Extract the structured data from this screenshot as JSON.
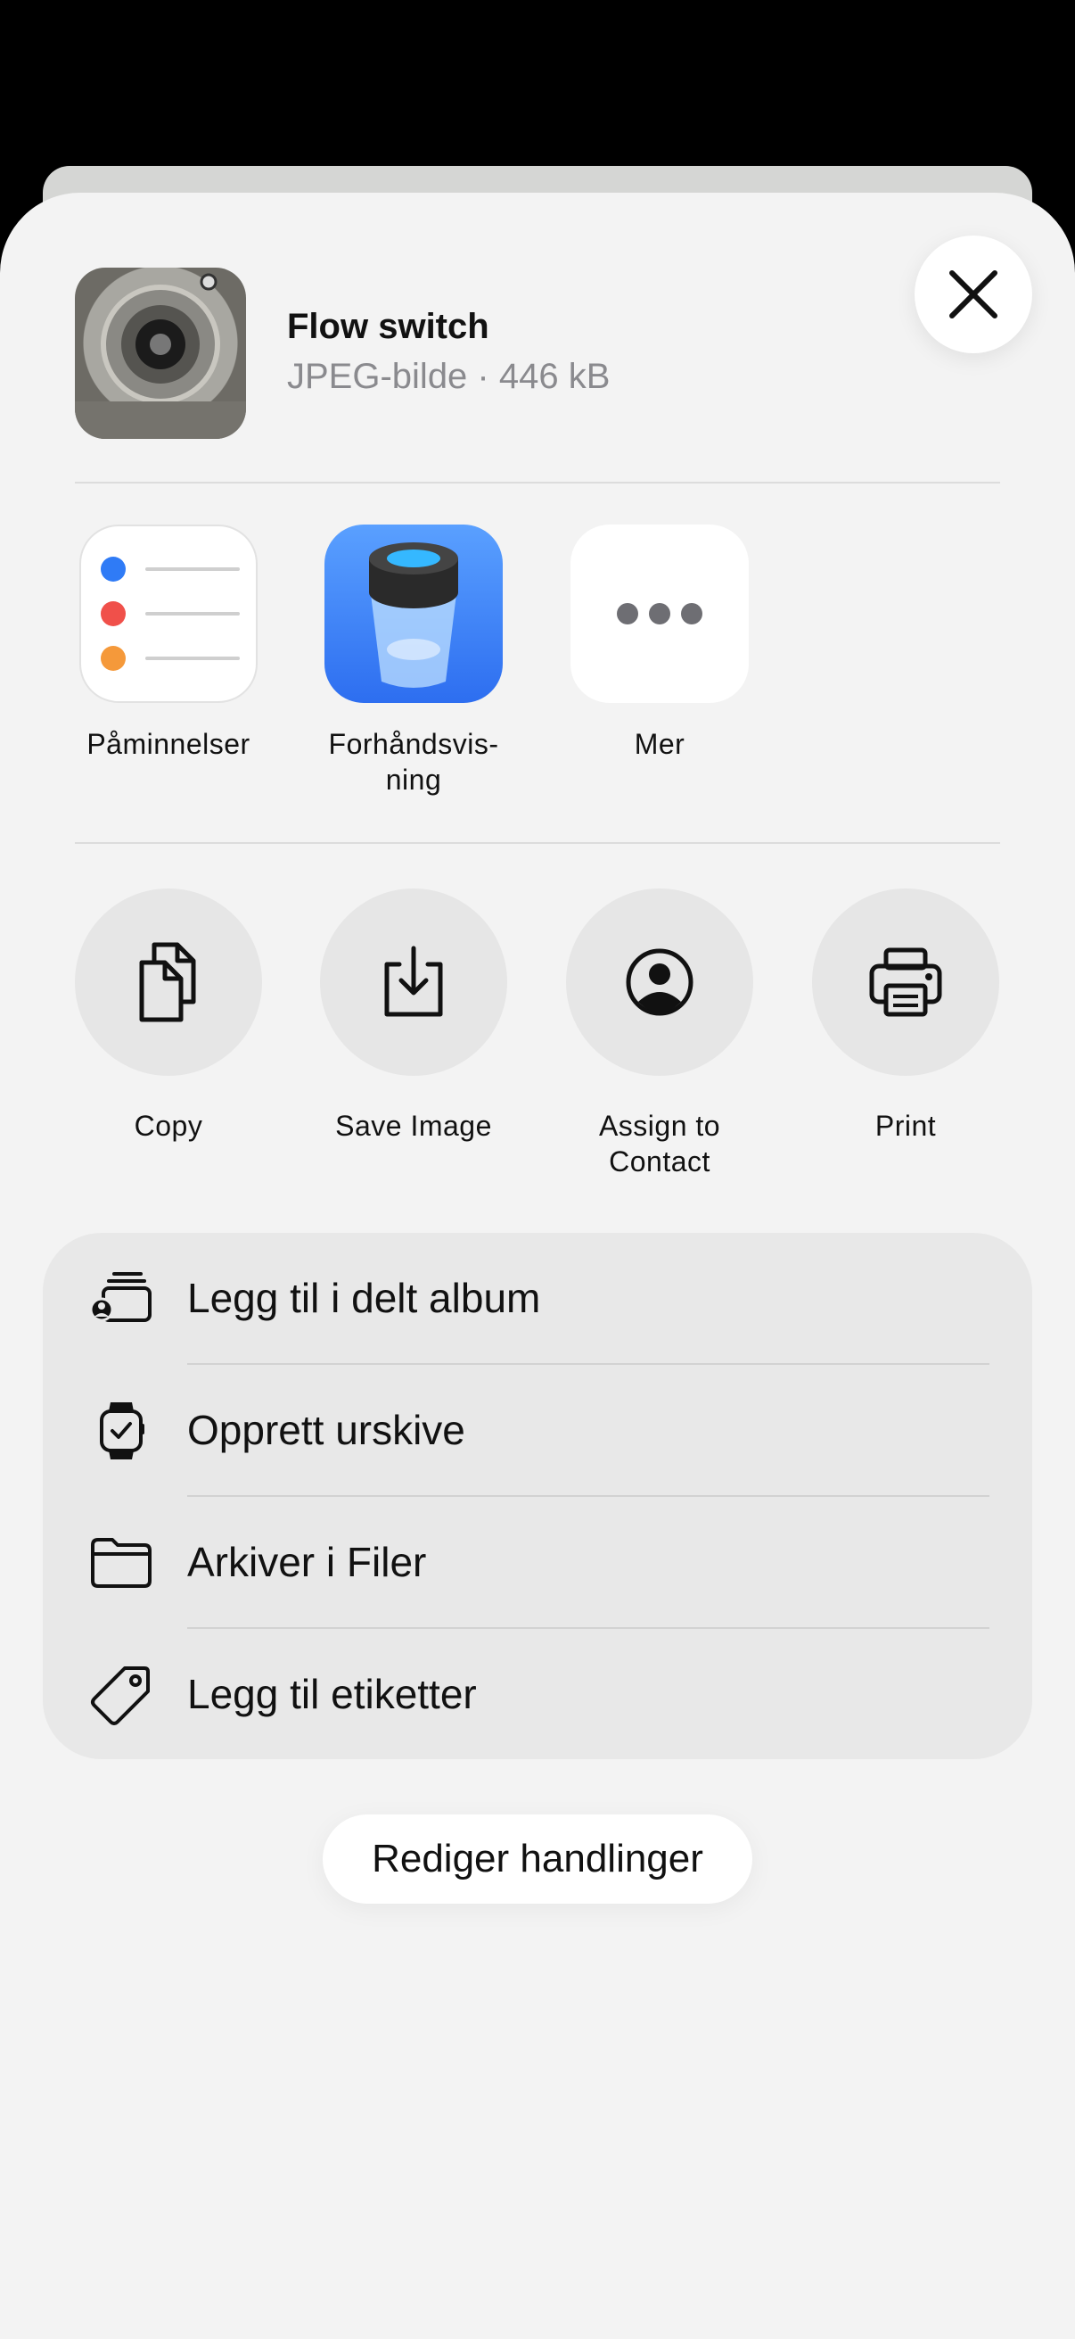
{
  "header": {
    "title": "Flow switch",
    "subtitle": "JPEG-bilde · 446 kB"
  },
  "apps": [
    {
      "label": "Påminnelser",
      "icon": "reminders-app-icon"
    },
    {
      "label": "Forhåndsvis-\nning",
      "icon": "preview-app-icon"
    },
    {
      "label": "Mer",
      "icon": "more-icon"
    }
  ],
  "actions": [
    {
      "label": "Copy",
      "icon": "copy-icon"
    },
    {
      "label": "Save Image",
      "icon": "save-image-icon"
    },
    {
      "label": "Assign to\nContact",
      "icon": "contact-icon"
    },
    {
      "label": "Print",
      "icon": "printer-icon"
    }
  ],
  "list": [
    {
      "label": "Legg til i delt album",
      "icon": "shared-album-icon"
    },
    {
      "label": "Opprett urskive",
      "icon": "watch-icon"
    },
    {
      "label": "Arkiver i Filer",
      "icon": "folder-icon"
    },
    {
      "label": "Legg til etiketter",
      "icon": "tag-icon"
    }
  ],
  "edit_actions_label": "Rediger handlinger",
  "colors": {
    "sheet_bg": "#f3f3f3",
    "preview_blue": "#3a86ff",
    "reminder_blue": "#2f7bf6",
    "reminder_red": "#f0504a",
    "reminder_orange": "#f5993a"
  }
}
